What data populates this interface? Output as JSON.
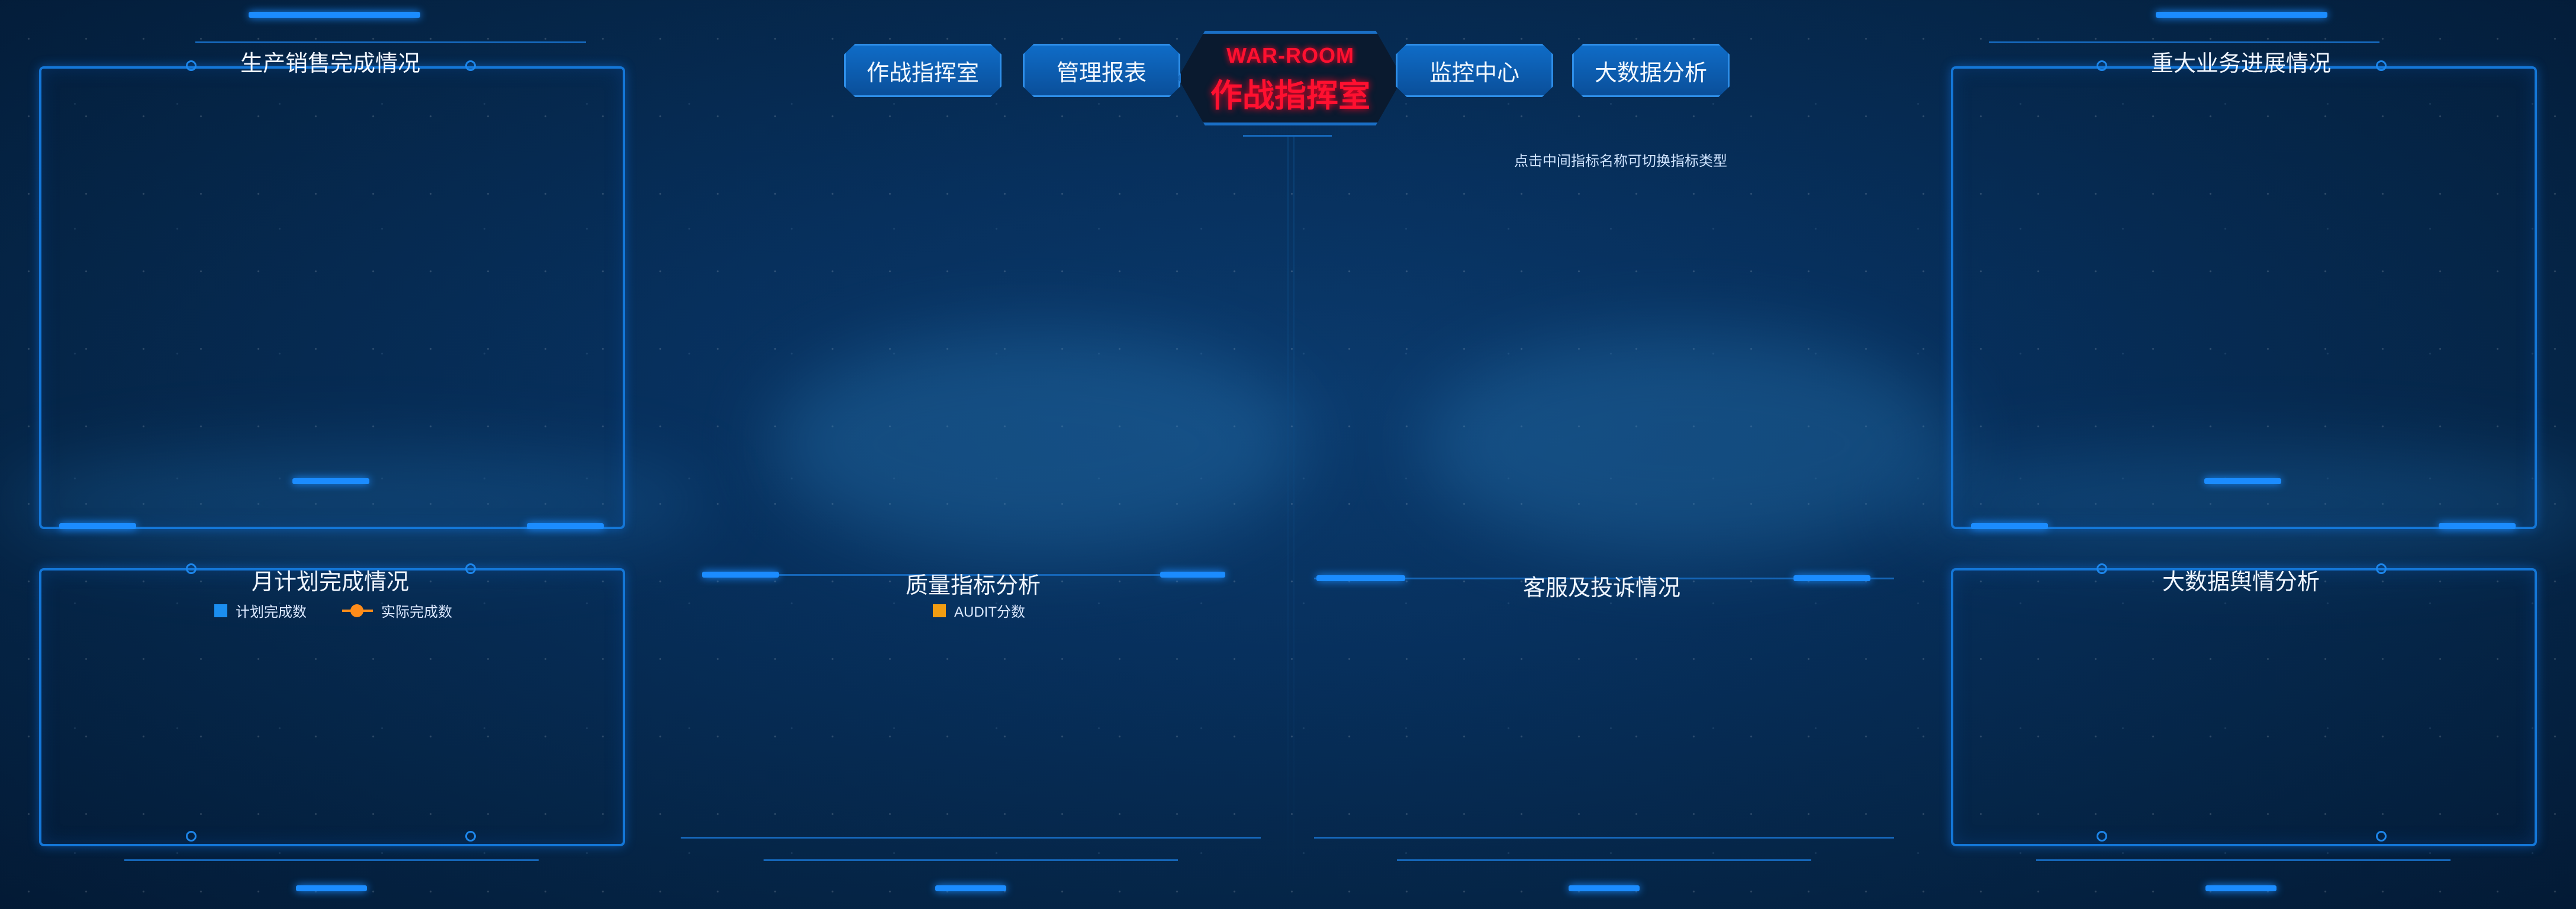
{
  "nav": {
    "left_buttons": [
      "作战指挥室",
      "管理报表"
    ],
    "right_buttons": [
      "监控中心",
      "大数据分析"
    ],
    "center_en": "WAR-ROOM",
    "center_cn": "作战指挥室",
    "hint": "点击中间指标名称可切换指标类型"
  },
  "panels": {
    "top_left_title": "生产销售完成情况",
    "top_right_title": "重大业务进展情况",
    "bottom_left_title": "月计划完成情况",
    "bottom_center_left_title": "质量指标分析",
    "bottom_center_right_title": "客服及投诉情况",
    "bottom_right_title": "大数据舆情分析"
  },
  "legends": {
    "monthly_plan": [
      "计划完成数",
      "实际完成数"
    ],
    "quality": [
      "AUDIT分数"
    ]
  },
  "colors": {
    "accent": "#1b8cff",
    "alert_red": "#ff1030",
    "plan_blue": "#1b8ef0",
    "actual_orange": "#ff8c1a",
    "audit_orange": "#f29d12"
  }
}
